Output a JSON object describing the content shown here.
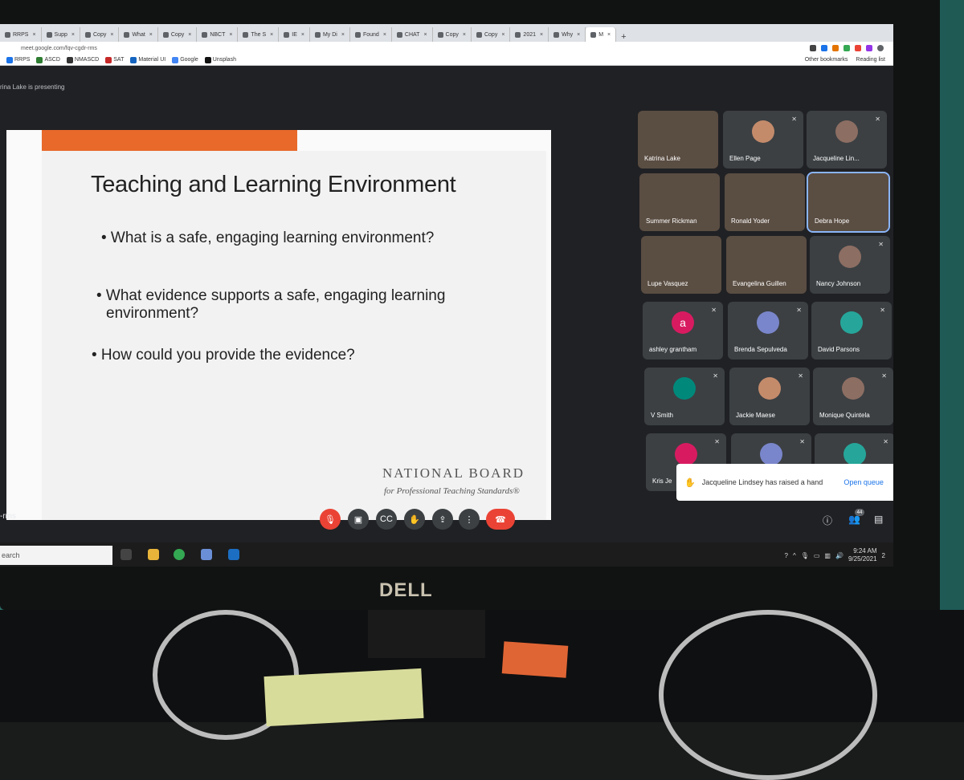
{
  "browser": {
    "tabs": [
      {
        "label": "RRPS"
      },
      {
        "label": "Supp"
      },
      {
        "label": "Copy"
      },
      {
        "label": "What"
      },
      {
        "label": "Copy"
      },
      {
        "label": "NBCT"
      },
      {
        "label": "The S"
      },
      {
        "label": "IE"
      },
      {
        "label": "My Di"
      },
      {
        "label": "Found"
      },
      {
        "label": "CHAT"
      },
      {
        "label": "Copy"
      },
      {
        "label": "Copy"
      },
      {
        "label": "2021"
      },
      {
        "label": "Why"
      },
      {
        "label": "M"
      }
    ],
    "url": "meet.google.com/fqv-cgdr-rms",
    "bookmarks": [
      "RRPS",
      "ASCD",
      "NMASCD",
      "SAT",
      "Material UI",
      "Google",
      "Unsplash"
    ],
    "other_bookmarks": "Other bookmarks",
    "reading_list": "Reading list"
  },
  "meet": {
    "presenting_text": "rina Lake is presenting",
    "meeting_code": "-rms",
    "participant_count": "44"
  },
  "slide": {
    "title": "Teaching and Learning Environment",
    "bullet_1": "• What is a safe, engaging learning environment?",
    "bullet_2_line1": "• What evidence supports a safe, engaging learning",
    "bullet_2_line2": "environment?",
    "bullet_3": "• How could you provide the evidence?",
    "logo_line1": "NATIONAL BOARD",
    "logo_line2": "for Professional Teaching Standards®"
  },
  "participants": [
    {
      "name": "Katrina Lake"
    },
    {
      "name": "Ellen Page"
    },
    {
      "name": "Jacqueline Lin..."
    },
    {
      "name": "Summer Rickman"
    },
    {
      "name": "Ronald Yoder"
    },
    {
      "name": "Debra Hope"
    },
    {
      "name": "Lupe Vasquez"
    },
    {
      "name": "Evangelina Guillen"
    },
    {
      "name": "Nancy Johnson"
    },
    {
      "name": "ashley grantham",
      "initial": "a"
    },
    {
      "name": "Brenda Sepulveda"
    },
    {
      "name": "David Parsons"
    },
    {
      "name": "V Smith"
    },
    {
      "name": "Jackie Maese"
    },
    {
      "name": "Monique Quintela"
    },
    {
      "name": "Kris Je"
    },
    {
      "name": ""
    },
    {
      "name": ""
    }
  ],
  "toast": {
    "message": "Jacqueline Lindsey has raised a hand",
    "action": "Open queue"
  },
  "taskbar": {
    "search": "earch",
    "time": "9:24 AM",
    "date": "9/25/2021",
    "notifications": "2"
  },
  "monitor": {
    "brand": "DELL"
  },
  "colors": {
    "end_call": "#ea4335",
    "slide_accent": "#e8692a",
    "link": "#1a73e8"
  }
}
